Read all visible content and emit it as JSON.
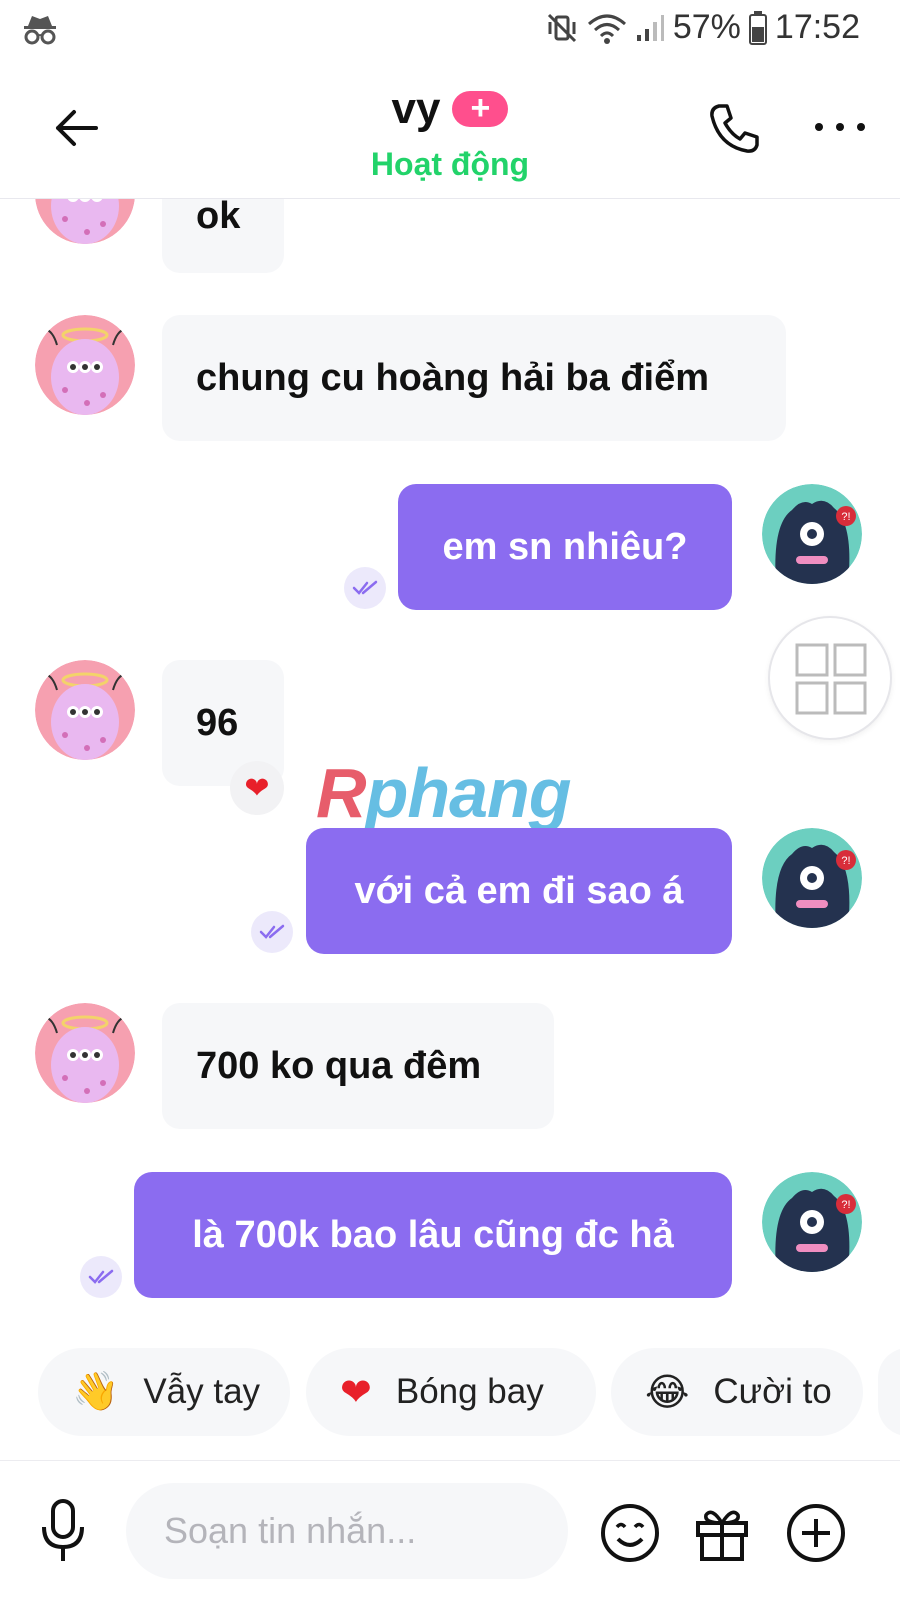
{
  "status_bar": {
    "battery": "57%",
    "time": "17:52"
  },
  "header": {
    "title": "vy",
    "badge": "+",
    "subtitle": "Hoạt động"
  },
  "messages": [
    {
      "side": "in",
      "text": "ok"
    },
    {
      "side": "in",
      "text": "chung cu hoàng hải ba điểm"
    },
    {
      "side": "out",
      "text": "em sn nhiêu?"
    },
    {
      "side": "in",
      "text": "96"
    },
    {
      "side": "out",
      "text": "với cả em đi sao á"
    },
    {
      "side": "in",
      "text": "700 ko qua đêm"
    },
    {
      "side": "out",
      "text": "là 700k bao lâu cũng đc hả"
    }
  ],
  "watermark": {
    "first": "R",
    "rest": "phang"
  },
  "quick_replies": [
    {
      "emoji": "👋",
      "label": "Vẫy tay"
    },
    {
      "emoji": "❤",
      "label": "Bóng bay"
    },
    {
      "emoji": "😂",
      "label": "Cười to"
    }
  ],
  "composer": {
    "placeholder": "Soạn tin nhắn..."
  },
  "colors": {
    "accent": "#8b6cf0",
    "online": "#22d36a",
    "badge": "#ff4f8d"
  }
}
